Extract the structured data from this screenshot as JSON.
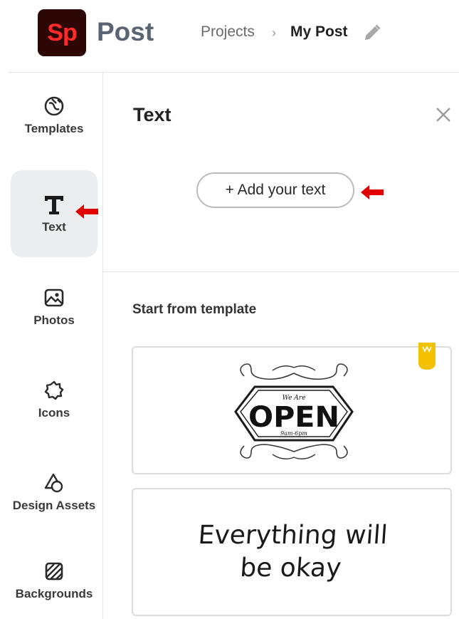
{
  "header": {
    "logo_text": "Sp",
    "app_title": "Post",
    "breadcrumb": {
      "projects": "Projects",
      "separator": "›",
      "current": "My Post"
    }
  },
  "rail": {
    "items": [
      {
        "label": "Templates",
        "icon": "templates-icon"
      },
      {
        "label": "Text",
        "icon": "text-icon",
        "active": true
      },
      {
        "label": "Photos",
        "icon": "photos-icon"
      },
      {
        "label": "Icons",
        "icon": "icons-icon"
      },
      {
        "label": "Design Assets",
        "icon": "design-assets-icon"
      },
      {
        "label": "Backgrounds",
        "icon": "backgrounds-icon"
      }
    ]
  },
  "panel": {
    "title": "Text",
    "add_text_button": "+ Add your text",
    "section_title": "Start from template",
    "templates": [
      {
        "lines": [
          "We Are",
          "OPEN",
          "9am-6pm"
        ],
        "premium": true
      },
      {
        "lines": [
          "Everything will",
          "be okay"
        ],
        "premium": false
      }
    ]
  },
  "colors": {
    "logo_bg": "#2d0606",
    "logo_text": "#ff2b2b",
    "arrow": "#e00000",
    "premium": "#f2c200",
    "active_bg": "#ecedef"
  }
}
